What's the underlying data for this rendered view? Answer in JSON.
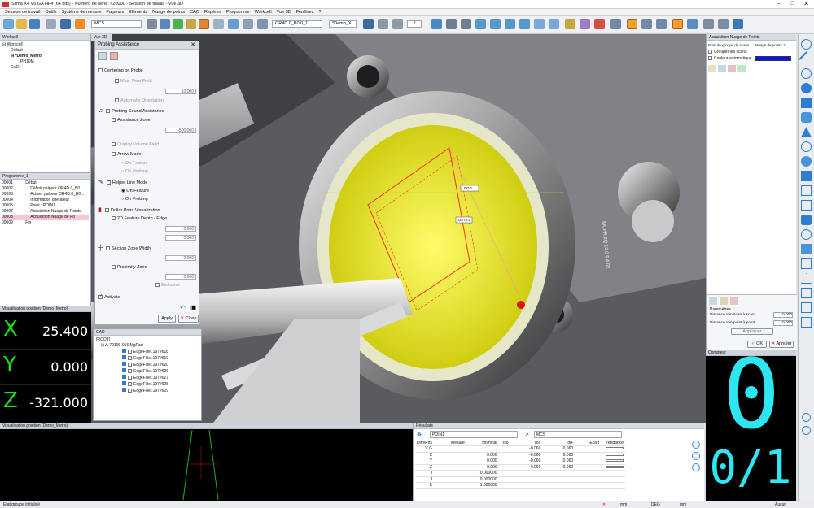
{
  "app": {
    "title": "Silma X4 V6 GA HF4 (64 bits) - Numéro de série: #20000 - Session de travail - Vue 3D"
  },
  "menu": [
    "Session de travail",
    "Outils",
    "Système de mesure",
    "Palpeurs",
    "Eléments",
    "Nuage de points",
    "CAO",
    "Repères",
    "Programme",
    "Workcell",
    "Vue 3D",
    "Fenêtres",
    "?"
  ],
  "toolbar": {
    "frame_select": "MCS",
    "probe_select": "OR4D.0_B0.0_1",
    "demo_select": "*Demo_X",
    "count_select": "2"
  },
  "workcell": {
    "title": "Workcell",
    "items": [
      "Workcell",
      "Défaut",
      "*Demo_Metro",
      "PH10M",
      "CAD"
    ]
  },
  "programme": {
    "title": "Programme_1",
    "rows": [
      {
        "n": "00001",
        "label": "Début"
      },
      {
        "n": "00002",
        "label": "Définir palpeur OR4D.0_B0..."
      },
      {
        "n": "00003",
        "label": "Activer palpeur OR4D.0_B0..."
      },
      {
        "n": "00004",
        "label": "Information opérateur"
      },
      {
        "n": "00005",
        "label": "Point : POIN1"
      },
      {
        "n": "00007",
        "label": "Acquisition Nuage de Points"
      },
      {
        "n": "00008",
        "label": "Acquisition Nuage de Po"
      },
      {
        "n": "00009",
        "label": "Fin"
      }
    ]
  },
  "dro": {
    "title": "Visualisation position (Demo_Metro)",
    "rows": [
      {
        "axis": "X",
        "value": "25.400"
      },
      {
        "axis": "Y",
        "value": "0.000"
      },
      {
        "axis": "Z",
        "value": "-321.000"
      }
    ]
  },
  "dro2": {
    "title": "Visualisation position (Demo_Metro)"
  },
  "probing": {
    "tab": "Vue 3D",
    "title": "Probing Assistance",
    "centering": "Centering on Probe",
    "max_view": "Max. View Field",
    "max_view_val": "10.000",
    "auto_orient": "Automatic Orientation",
    "sound": "Probing Sound Assistance",
    "assist_zone": "Assistance Zone",
    "assist_val": "-500.000",
    "display_vol": "Display Volume Field",
    "arrow_mode": "Arrow Mode",
    "on_feature": "On Feature",
    "on_probing": "On Probing",
    "helper": "Helper Line Mode",
    "helper_feature": "On Feature",
    "helper_probing": "On Probing",
    "dollar": "Dollar Point Visualization",
    "feature_depth": "2D Feature Depth / Edge",
    "fd_val1": "0.000",
    "fd_val2": "0.000",
    "section": "Section Zone Width",
    "section_val": "0.000",
    "proximity": "Proximity Zone",
    "prox_val": "0.000",
    "exclusive": "Exclusive",
    "activate": "Activate",
    "apply": "Apply",
    "close": "Close"
  },
  "cad": {
    "title": "CAD",
    "root": "[ROOT]",
    "part": "A-70106-016.MgPart",
    "items": [
      "EdgeFillet.197#618",
      "EdgeFillet.197#619",
      "EdgeFillet.197#620",
      "EdgeFillet.197#626",
      "EdgeFillet.197#627",
      "EdgeFillet.197#628",
      "EdgeFillet.197#629"
    ]
  },
  "view3d": {
    "tag1": "POI1",
    "tag2": "DAT0.2",
    "engrave": "MCPR.2Q 10.0 R4.02"
  },
  "acq": {
    "title": "Acquisition Nuage de Points",
    "col": "Nom du groupe de scans",
    "col2": "Nuage de points 1",
    "grouper": "Grouper les scans",
    "couleur": "Couleur automatique",
    "param": "Paramètres",
    "dist_scan": "Distance min scan à scan",
    "dist_scan_val": "0.000",
    "dist_point": "Distance min point à point",
    "dist_point_val": "0.000",
    "appliquer": "Appliquer",
    "ok": "OK",
    "annuler": "Annuler",
    "color": "#0a14f0"
  },
  "compteur": {
    "title": "Compteur",
    "big": "0",
    "small": "0/1",
    "color": "#2ee6f2"
  },
  "results": {
    "title": "Résultats",
    "point": "POIN1",
    "frame": "MCS",
    "headers": [
      "Dim/Pos",
      "Mesuré",
      "Nominal",
      "Iso",
      "Tol-",
      "Tol+",
      "Ecart",
      "Tendance"
    ],
    "rows": [
      {
        "n": "V G",
        "meas": "",
        "nom": "",
        "tm": "-0.060",
        "tp": "0.060"
      },
      {
        "n": "X",
        "meas": "",
        "nom": "0.000",
        "tm": "-0.060",
        "tp": "0.060"
      },
      {
        "n": "Y",
        "meas": "",
        "nom": "0.000",
        "tm": "-0.060",
        "tp": "0.060"
      },
      {
        "n": "Z",
        "meas": "",
        "nom": "0.000",
        "tm": "-0.060",
        "tp": "0.060"
      },
      {
        "n": "I",
        "meas": "",
        "nom": "0.000000",
        "tm": "",
        "tp": ""
      },
      {
        "n": "J",
        "meas": "",
        "nom": "0.000000",
        "tm": "",
        "tp": ""
      },
      {
        "n": "K",
        "meas": "",
        "nom": "1.000000",
        "tm": "",
        "tp": ""
      }
    ]
  },
  "status": {
    "left": "Etat groupe initialisé",
    "mm": "mm",
    "units": "DEG",
    "unit2": "mm",
    "aucun": "Aucun"
  }
}
